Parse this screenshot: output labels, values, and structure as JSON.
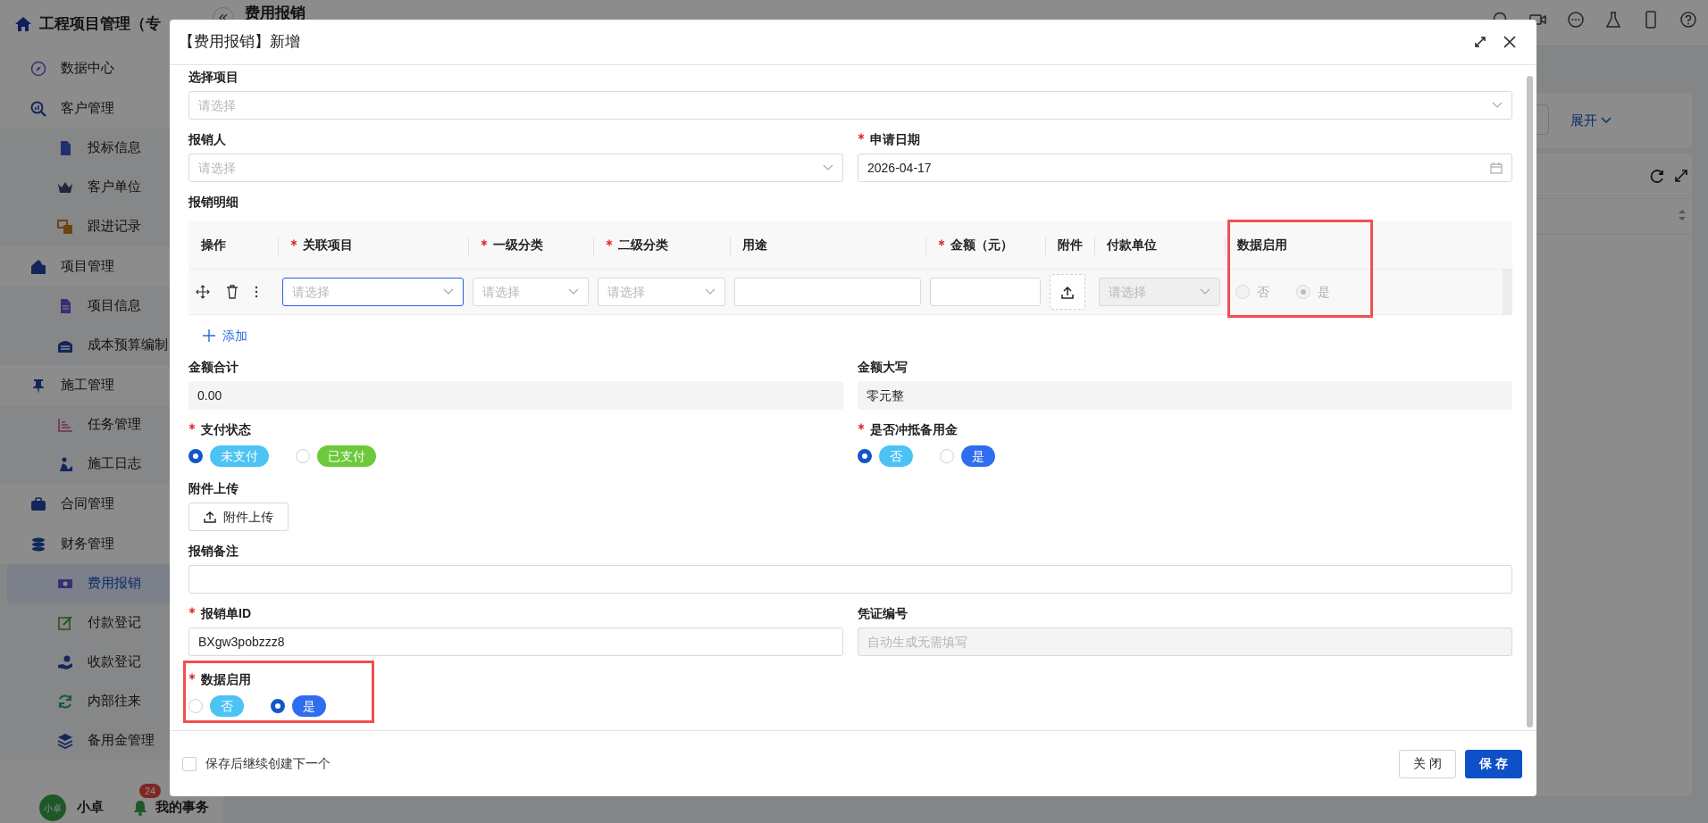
{
  "app": {
    "title": "工程项目管理（专",
    "page_title": "费用报销",
    "expand_link": "展开"
  },
  "sidebar": [
    {
      "label": "数据中心",
      "selected": false
    },
    {
      "label": "客户管理",
      "selected": false,
      "children": [
        {
          "label": "投标信息",
          "selected": false
        },
        {
          "label": "客户单位",
          "selected": false
        },
        {
          "label": "跟进记录",
          "selected": false
        }
      ]
    },
    {
      "label": "项目管理",
      "selected": false,
      "children": [
        {
          "label": "项目信息",
          "selected": false
        },
        {
          "label": "成本预算编制",
          "selected": false
        }
      ]
    },
    {
      "label": "施工管理",
      "selected": false,
      "children": [
        {
          "label": "任务管理",
          "selected": false
        },
        {
          "label": "施工日志",
          "selected": false
        }
      ]
    },
    {
      "label": "合同管理",
      "selected": false
    },
    {
      "label": "财务管理",
      "selected": false,
      "children": [
        {
          "label": "费用报销",
          "selected": true
        },
        {
          "label": "付款登记",
          "selected": false
        },
        {
          "label": "收款登记",
          "selected": false
        },
        {
          "label": "内部往来",
          "selected": false
        },
        {
          "label": "备用金管理",
          "selected": false
        }
      ]
    }
  ],
  "user": {
    "avatar": "小卓",
    "name": "小卓"
  },
  "tasks": {
    "badge": "24",
    "label": "我的事务"
  },
  "modal": {
    "title": "【费用报销】新增",
    "rows": [
      {
        "fields": [
          {
            "kind": "select",
            "label": "选择项目",
            "required": false,
            "highlighted": false,
            "placeholder": "请选择"
          }
        ]
      },
      {
        "fields": [
          {
            "kind": "select",
            "label": "报销人",
            "required": false,
            "highlighted": false,
            "placeholder": "请选择"
          },
          {
            "kind": "date",
            "label": "申请日期",
            "required": true,
            "highlighted": false,
            "value": "2026-04-17"
          }
        ]
      },
      {
        "fields": [
          {
            "kind": "table",
            "label": "报销明细",
            "required": false,
            "highlighted": false,
            "columns": [
              {
                "label": "操作",
                "required": false,
                "highlighted": false
              },
              {
                "label": "关联项目",
                "required": true,
                "highlighted": false
              },
              {
                "label": "一级分类",
                "required": true,
                "highlighted": false
              },
              {
                "label": "二级分类",
                "required": true,
                "highlighted": false
              },
              {
                "label": "用途",
                "required": false,
                "highlighted": false
              },
              {
                "label": "金额（元）",
                "required": true,
                "highlighted": false
              },
              {
                "label": "附件",
                "required": false,
                "highlighted": false
              },
              {
                "label": "付款单位",
                "required": false,
                "highlighted": false
              },
              {
                "label": "数据启用",
                "required": false,
                "highlighted": true
              }
            ],
            "rows": [
              {
                "cells": [
                  {
                    "kind": "actions"
                  },
                  {
                    "kind": "select",
                    "placeholder": "请选择",
                    "focused": true,
                    "disabled": false
                  },
                  {
                    "kind": "select",
                    "placeholder": "请选择",
                    "focused": false,
                    "disabled": false
                  },
                  {
                    "kind": "select",
                    "placeholder": "请选择",
                    "focused": false,
                    "disabled": false
                  },
                  {
                    "kind": "input"
                  },
                  {
                    "kind": "input"
                  },
                  {
                    "kind": "upload"
                  },
                  {
                    "kind": "select",
                    "placeholder": "请选择",
                    "focused": false,
                    "disabled": true
                  },
                  {
                    "kind": "radio",
                    "disabled": true,
                    "options": [
                      {
                        "label": "否",
                        "selected": false
                      },
                      {
                        "label": "是",
                        "selected": true
                      }
                    ]
                  }
                ]
              }
            ],
            "add": "添加"
          }
        ]
      },
      {
        "fields": [
          {
            "kind": "readonly",
            "label": "金额合计",
            "required": false,
            "highlighted": false,
            "value": "0.00"
          },
          {
            "kind": "readonly",
            "label": "金额大写",
            "required": false,
            "highlighted": false,
            "value": "零元整"
          }
        ]
      },
      {
        "fields": [
          {
            "kind": "radio",
            "label": "支付状态",
            "required": true,
            "highlighted": false,
            "options": [
              {
                "label": "未支付",
                "selected": true,
                "color": "#4cc2f5"
              },
              {
                "label": "已支付",
                "selected": false,
                "color": "#6cc93a"
              }
            ]
          },
          {
            "kind": "radio",
            "label": "是否冲抵备用金",
            "required": true,
            "highlighted": false,
            "options": [
              {
                "label": "否",
                "selected": true,
                "color": "#4cc2f5"
              },
              {
                "label": "是",
                "selected": false,
                "color": "#2f6df0"
              }
            ]
          }
        ]
      },
      {
        "fields": [
          {
            "kind": "upload",
            "label": "附件上传",
            "required": false,
            "highlighted": false,
            "button": "附件上传"
          }
        ]
      },
      {
        "fields": [
          {
            "kind": "text",
            "label": "报销备注",
            "required": false,
            "highlighted": false
          }
        ]
      },
      {
        "fields": [
          {
            "kind": "text",
            "label": "报销单ID",
            "required": true,
            "highlighted": false,
            "value": "BXgw3pobzzz8"
          },
          {
            "kind": "disabled",
            "label": "凭证编号",
            "required": false,
            "highlighted": false,
            "placeholder": "自动生成无需填写"
          }
        ]
      },
      {
        "fields": [
          {
            "kind": "radio",
            "label": "数据启用",
            "required": true,
            "highlighted": true,
            "options": [
              {
                "label": "否",
                "selected": false,
                "color": "#4cc2f5"
              },
              {
                "label": "是",
                "selected": true,
                "color": "#2f6df0"
              }
            ]
          }
        ]
      }
    ],
    "footer": {
      "checkbox": {
        "label": "保存后继续创建下一个",
        "checked": false
      },
      "buttons": [
        {
          "label": "关闭",
          "kind": "secondary"
        },
        {
          "label": "保存",
          "kind": "primary"
        }
      ]
    }
  }
}
